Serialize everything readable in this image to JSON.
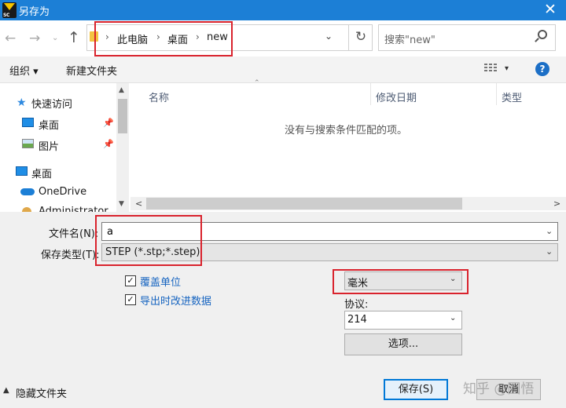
{
  "window": {
    "title": "另存为"
  },
  "address": {
    "crumbs": [
      "此电脑",
      "桌面",
      "new"
    ]
  },
  "search": {
    "placeholder": "搜索\"new\""
  },
  "toolbar": {
    "organize": "组织 ▾",
    "new_folder": "新建文件夹"
  },
  "nav_tree": {
    "quick_access": "快速访问",
    "desktop_pinned": "桌面",
    "pictures": "图片",
    "desktop": "桌面",
    "onedrive": "OneDrive",
    "administrator": "Administrator"
  },
  "columns": [
    "名称",
    "修改日期",
    "类型"
  ],
  "empty_message": "没有与搜索条件匹配的项。",
  "form": {
    "filename_label": "文件名(N):",
    "filename_value": "a",
    "filetype_label": "保存类型(T):",
    "filetype_value": "STEP (*.stp;*.step)"
  },
  "options": {
    "overwrite_units": "覆盖单位",
    "export_improved": "导出时改进数据",
    "unit_value": "毫米",
    "protocol_label": "协议:",
    "protocol_value": "214",
    "options_button": "选项..."
  },
  "footer": {
    "hide_folders": "隐藏文件夹",
    "save": "保存(S)",
    "cancel": "取消",
    "watermark": "知乎 @图悟"
  },
  "colors": {
    "titlebar": "#1c7fd6",
    "highlight": "#d9232d",
    "link": "#1664c0"
  }
}
